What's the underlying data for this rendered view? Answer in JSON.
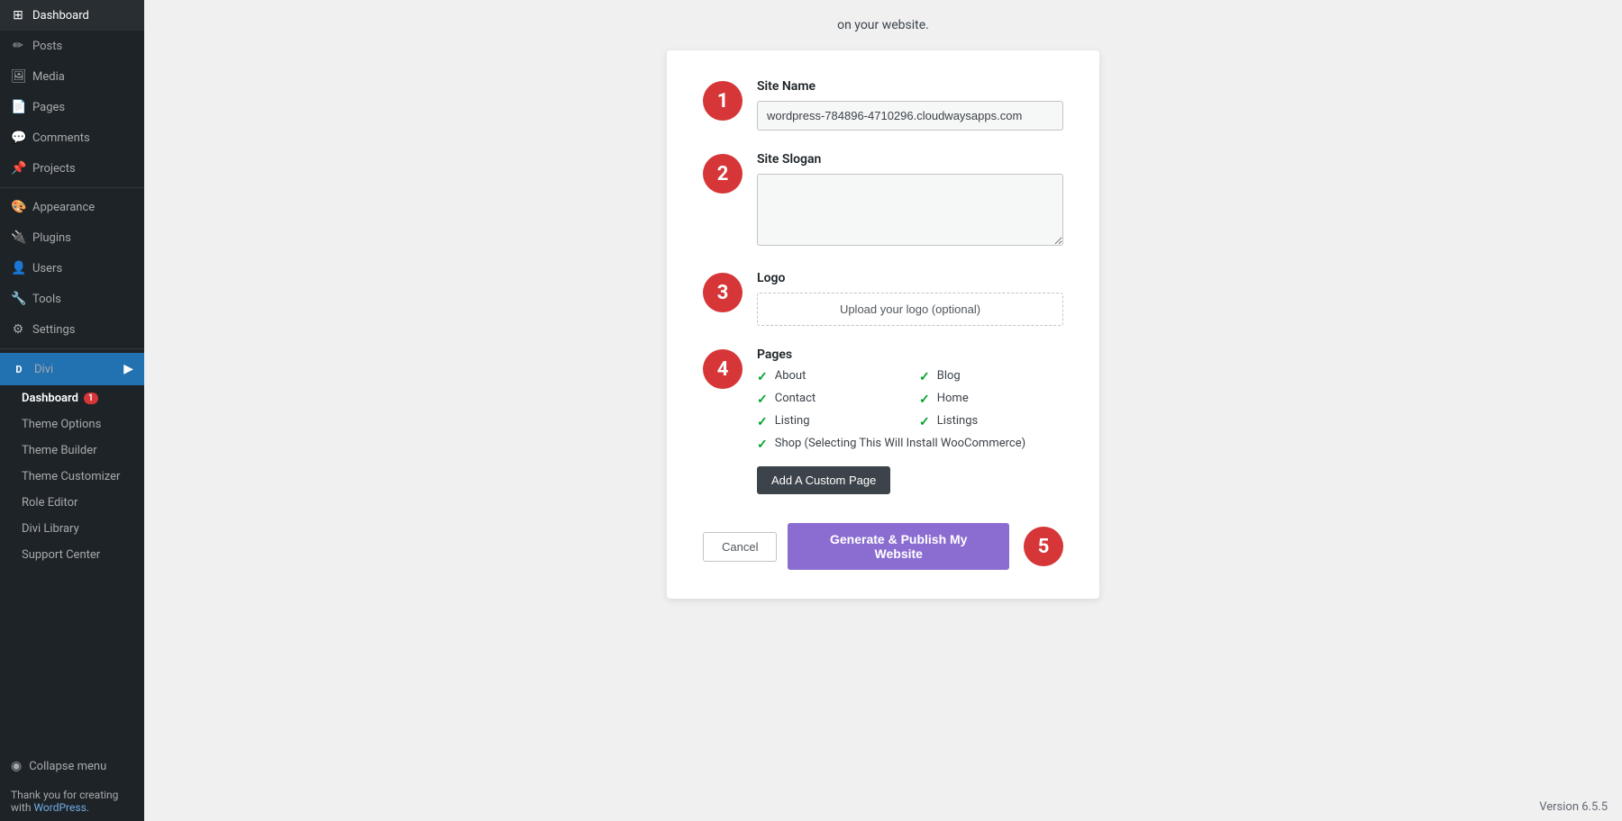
{
  "sidebar": {
    "items": [
      {
        "id": "dashboard",
        "label": "Dashboard",
        "icon": "⊞"
      },
      {
        "id": "posts",
        "label": "Posts",
        "icon": "✏"
      },
      {
        "id": "media",
        "label": "Media",
        "icon": "🖼"
      },
      {
        "id": "pages",
        "label": "Pages",
        "icon": "📄"
      },
      {
        "id": "comments",
        "label": "Comments",
        "icon": "💬"
      },
      {
        "id": "projects",
        "label": "Projects",
        "icon": "📌"
      },
      {
        "id": "appearance",
        "label": "Appearance",
        "icon": "🎨"
      },
      {
        "id": "plugins",
        "label": "Plugins",
        "icon": "🔌"
      },
      {
        "id": "users",
        "label": "Users",
        "icon": "👤"
      },
      {
        "id": "tools",
        "label": "Tools",
        "icon": "🔧"
      },
      {
        "id": "settings",
        "label": "Settings",
        "icon": "⚙"
      }
    ],
    "divi": {
      "label": "Divi",
      "sub_items": [
        {
          "id": "divi-dashboard",
          "label": "Dashboard",
          "badge": "1"
        },
        {
          "id": "theme-options",
          "label": "Theme Options"
        },
        {
          "id": "theme-builder",
          "label": "Theme Builder"
        },
        {
          "id": "theme-customizer",
          "label": "Theme Customizer"
        },
        {
          "id": "role-editor",
          "label": "Role Editor"
        },
        {
          "id": "divi-library",
          "label": "Divi Library"
        },
        {
          "id": "support-center",
          "label": "Support Center"
        }
      ]
    },
    "collapse_label": "Collapse menu"
  },
  "main": {
    "top_text": "on your website.",
    "dialog": {
      "step1": {
        "number": "1",
        "label": "Site Name",
        "input_value": "wordpress-784896-4710296.cloudwaysapps.com",
        "placeholder": ""
      },
      "step2": {
        "number": "2",
        "label": "Site Slogan",
        "placeholder": ""
      },
      "step3": {
        "number": "3",
        "label": "Logo",
        "upload_label": "Upload your logo (optional)"
      },
      "step4": {
        "number": "4",
        "label": "Pages",
        "pages": [
          {
            "name": "About",
            "checked": true
          },
          {
            "name": "Blog",
            "checked": true
          },
          {
            "name": "Contact",
            "checked": true
          },
          {
            "name": "Home",
            "checked": true
          },
          {
            "name": "Listing",
            "checked": true
          },
          {
            "name": "Listings",
            "checked": true
          },
          {
            "name": "Shop (Selecting This Will Install WooCommerce)",
            "checked": true,
            "wide": true
          }
        ],
        "add_custom_page_label": "Add A Custom Page"
      },
      "buttons": {
        "cancel_label": "Cancel",
        "generate_label": "Generate & Publish My Website"
      },
      "step5": {
        "number": "5"
      }
    }
  },
  "footer": {
    "text_before_link": "Thank you for creating with ",
    "link_label": "WordPress",
    "text_after": ".",
    "version": "Version 6.5.5"
  }
}
